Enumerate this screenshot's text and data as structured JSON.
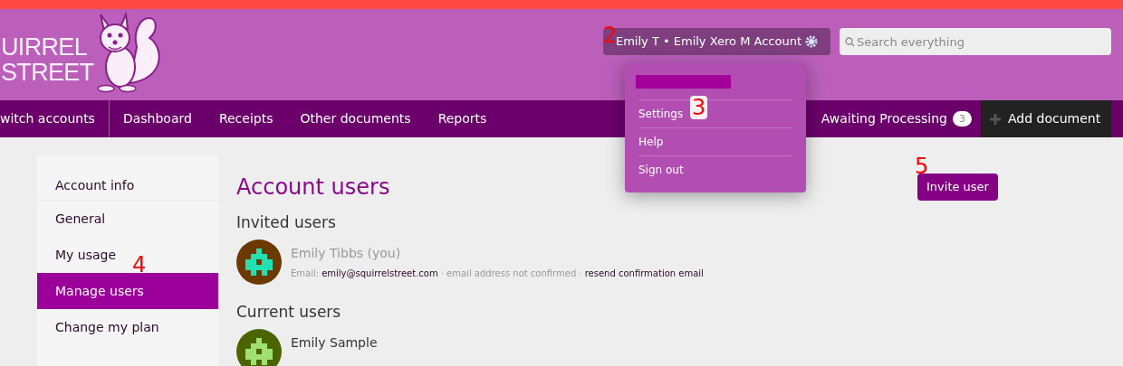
{
  "logo": {
    "lines": [
      "UIRREL",
      "STREET"
    ]
  },
  "account_button": {
    "label": "Emily T • Emily Xero M Account"
  },
  "search": {
    "placeholder": "Search everything"
  },
  "nav": {
    "items": [
      {
        "label": "witch accounts",
        "kind": "switch"
      },
      {
        "label": "Dashboard",
        "kind": "link"
      },
      {
        "label": "Receipts",
        "kind": "link"
      },
      {
        "label": "Other documents",
        "kind": "link"
      },
      {
        "label": "Reports",
        "kind": "link"
      }
    ],
    "awaiting": {
      "label": "Awaiting Processing",
      "count": "3"
    },
    "add_document": {
      "label": "Add document"
    }
  },
  "dropdown": {
    "items": [
      "Settings",
      "Help",
      "Sign out"
    ]
  },
  "sidebar": {
    "items": [
      {
        "label": "Account info",
        "kind": "header",
        "selected": false
      },
      {
        "label": "General",
        "kind": "item",
        "selected": false
      },
      {
        "label": "My usage",
        "kind": "item",
        "selected": false
      },
      {
        "label": "Manage users",
        "kind": "item",
        "selected": true
      },
      {
        "label": "Change my plan",
        "kind": "item",
        "selected": false
      }
    ]
  },
  "main": {
    "title": "Account users",
    "invite_button": "Invite user",
    "sections": [
      {
        "heading": "Invited users",
        "users": [
          {
            "name": "Emily Tibbs (you)",
            "pending": true,
            "email_label": "Email:",
            "email": "emily@squirrelstreet.com",
            "note": "· email address not confirmed ·",
            "action": "resend confirmation email"
          }
        ]
      },
      {
        "heading": "Current users",
        "users": [
          {
            "name": "Emily Sample",
            "pending": false
          }
        ]
      }
    ]
  },
  "annotations": [
    "2",
    "3",
    "4",
    "5"
  ]
}
